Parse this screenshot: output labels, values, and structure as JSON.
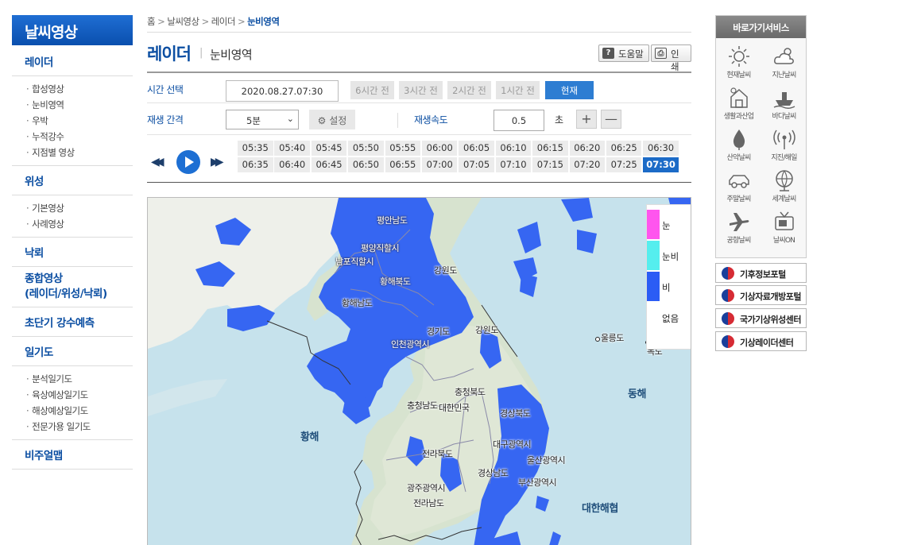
{
  "sidebar": {
    "brand": "날씨영상",
    "categories": [
      {
        "label": "레이더",
        "items": [
          "합성영상",
          "눈비영역",
          "우박",
          "누적강수",
          "지점별 영상"
        ]
      },
      {
        "label": "위성",
        "items": [
          "기본영상",
          "사례영상"
        ]
      },
      {
        "label": "낙뢰"
      },
      {
        "label": "종합영상\n(레이더/위성/낙뢰)"
      },
      {
        "label": "초단기 강수예측"
      },
      {
        "label": "일기도",
        "items": [
          "분석일기도",
          "육상예상일기도",
          "해상예상일기도",
          "전문가용 일기도"
        ]
      },
      {
        "label": "비주얼맵"
      }
    ]
  },
  "breadcrumb": [
    "홈",
    "날씨영상",
    "레이더",
    "눈비영역"
  ],
  "title": {
    "main": "레이더",
    "sub": "눈비영역",
    "help": "도움말",
    "print": "인쇄"
  },
  "controls": {
    "time_label": "시간 선택",
    "time_value": "2020.08.27.07:30",
    "hour_buttons": [
      "6시간 전",
      "3시간 전",
      "2시간 전",
      "1시간 전"
    ],
    "now_button": "현재",
    "interval_label": "재생 간격",
    "interval_value": "5분",
    "setting_button": "설정",
    "speed_label": "재생속도",
    "speed_value": "0.5",
    "speed_unit": "초",
    "plus": "+",
    "minus": "—"
  },
  "frames": [
    "05:35",
    "05:40",
    "05:45",
    "05:50",
    "05:55",
    "06:00",
    "06:05",
    "06:10",
    "06:15",
    "06:20",
    "06:25",
    "06:30",
    "06:35",
    "06:40",
    "06:45",
    "06:50",
    "06:55",
    "07:00",
    "07:05",
    "07:10",
    "07:15",
    "07:20",
    "07:25",
    "07:30"
  ],
  "active_frame": "07:30",
  "legend": [
    {
      "label": "눈",
      "color": "#ff55ee"
    },
    {
      "label": "눈비",
      "color": "#55eeee"
    },
    {
      "label": "비",
      "color": "#2b5cf5"
    },
    {
      "label": "없음",
      "color": "#ffffff"
    }
  ],
  "map_labels": {
    "pyongnam": "평안남도",
    "pyongyang": "평양직할시",
    "nampo": "남포직할시",
    "hwangbuk": "황해북도",
    "gangwon_n": "강원도",
    "hwangnam": "황해남도",
    "gyeonggi": "경기도",
    "gangwon_s": "강원도",
    "incheon": "인천광역시",
    "ulleung": "울릉도",
    "dokdo": "독도",
    "east_sea": "동해",
    "chungbuk": "충청북도",
    "chungnam": "충청남도",
    "korea": "대한민국",
    "gyeongbuk": "경상북도",
    "yellow_sea": "황해",
    "daegu": "대구광역시",
    "ulsan": "울산광역시",
    "jeonbuk": "전라북도",
    "gyeongnam": "경상남도",
    "busan": "부산광역시",
    "gwangju": "광주광역시",
    "jeonnam": "전라남도",
    "strait": "대한해협"
  },
  "quick": {
    "header": "바로가기서비스",
    "items": [
      {
        "label": "현재날씨",
        "icon": "sun-icon"
      },
      {
        "label": "지난날씨",
        "icon": "cloud-sun-icon"
      },
      {
        "label": "생활과산업",
        "icon": "house-icon"
      },
      {
        "label": "바다날씨",
        "icon": "ship-icon"
      },
      {
        "label": "산악날씨",
        "icon": "mountain-drop-icon"
      },
      {
        "label": "지진/해일",
        "icon": "seismic-icon"
      },
      {
        "label": "주말날씨",
        "icon": "car-icon"
      },
      {
        "label": "세계날씨",
        "icon": "globe-icon"
      },
      {
        "label": "공항날씨",
        "icon": "airplane-icon"
      },
      {
        "label": "날씨ON",
        "icon": "tv-icon"
      }
    ]
  },
  "portals": [
    "기후정보포털",
    "기상자료개방포털",
    "국가기상위성센터",
    "기상레이더센터"
  ]
}
